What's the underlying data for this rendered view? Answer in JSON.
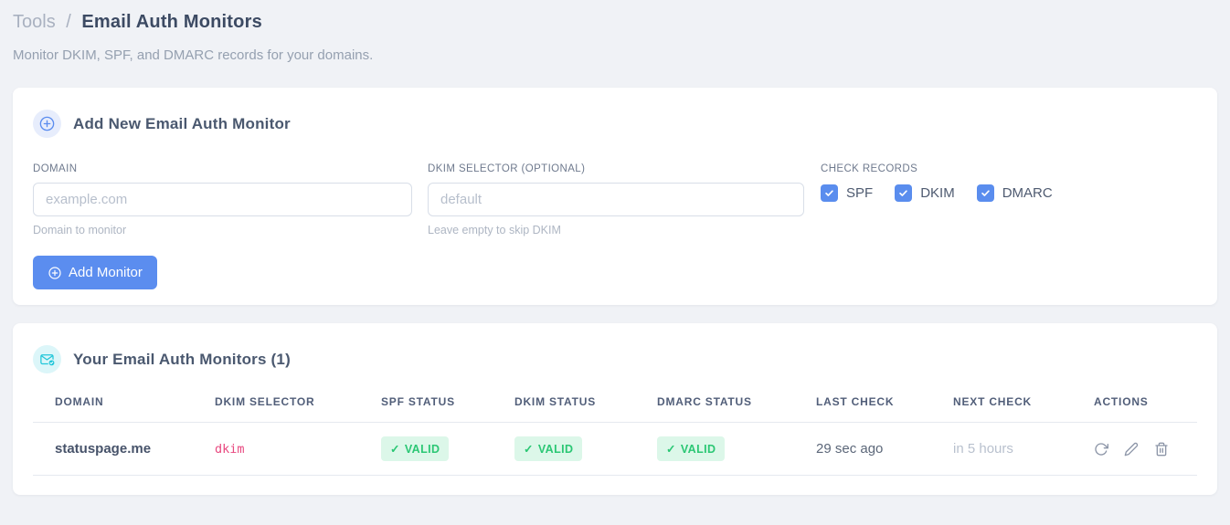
{
  "page": {
    "breadcrumb_section": "Tools",
    "breadcrumb_separator": "/",
    "title": "Email Auth Monitors",
    "subtitle": "Monitor DKIM, SPF, and DMARC records for your domains."
  },
  "add_monitor_card": {
    "title": "Add New Email Auth Monitor",
    "fields": {
      "domain": {
        "label": "DOMAIN",
        "value": "",
        "placeholder": "example.com",
        "helper": "Domain to monitor"
      },
      "dkim_selector": {
        "label": "DKIM SELECTOR (OPTIONAL)",
        "value": "",
        "placeholder": "default",
        "helper": "Leave empty to skip DKIM"
      }
    },
    "check_records": {
      "label": "CHECK RECORDS",
      "options": [
        {
          "label": "SPF",
          "checked": true
        },
        {
          "label": "DKIM",
          "checked": true
        },
        {
          "label": "DMARC",
          "checked": true
        }
      ]
    },
    "submit_label": "Add Monitor"
  },
  "monitors_card": {
    "title": "Your Email Auth Monitors (1)",
    "table": {
      "columns": [
        "DOMAIN",
        "DKIM SELECTOR",
        "SPF STATUS",
        "DKIM STATUS",
        "DMARC STATUS",
        "LAST CHECK",
        "NEXT CHECK",
        "ACTIONS"
      ],
      "rows": [
        {
          "domain": "statuspage.me",
          "dkim_selector": "dkim",
          "spf_status": "VALID",
          "dkim_status": "VALID",
          "dmarc_status": "VALID",
          "last_check": "29 sec ago",
          "next_check": "in 5 hours"
        }
      ]
    },
    "valid_glyph": "✓"
  },
  "icons": {
    "add_card_header": "plus-circle",
    "monitors_card_header": "envelope-check",
    "submit_button": "plus-circle",
    "row_actions": [
      "refresh",
      "edit",
      "delete"
    ]
  },
  "colors": {
    "accent_blue": "#5b8def",
    "accent_cyan": "#21c6d9",
    "valid_green": "#2bc774",
    "valid_green_bg": "#dcf7e9",
    "selector_pink": "#e8487f",
    "page_bg": "#f0f2f6"
  }
}
